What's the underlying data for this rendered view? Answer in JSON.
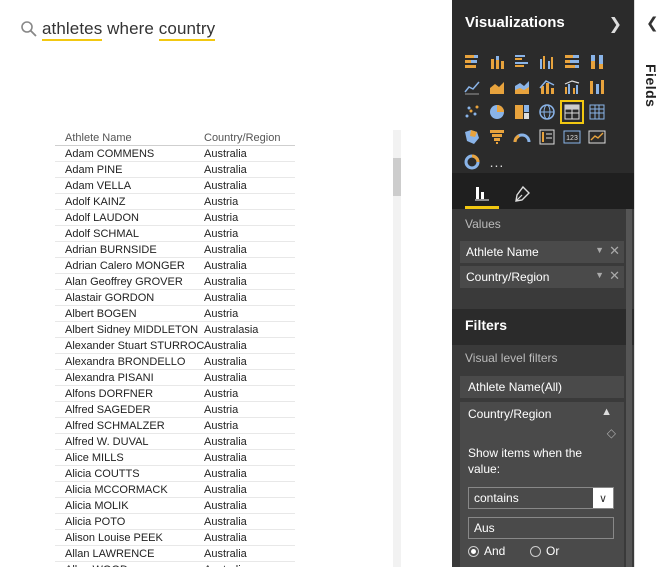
{
  "qna": {
    "words": [
      {
        "text": "athletes",
        "highlight": true
      },
      {
        "text": " where ",
        "highlight": false
      },
      {
        "text": "country",
        "highlight": true
      }
    ]
  },
  "table": {
    "headers": [
      "Athlete Name",
      "Country/Region"
    ],
    "rows": [
      [
        "Adam COMMENS",
        "Australia"
      ],
      [
        "Adam PINE",
        "Australia"
      ],
      [
        "Adam VELLA",
        "Australia"
      ],
      [
        "Adolf KAINZ",
        "Austria"
      ],
      [
        "Adolf LAUDON",
        "Austria"
      ],
      [
        "Adolf SCHMAL",
        "Austria"
      ],
      [
        "Adrian BURNSIDE",
        "Australia"
      ],
      [
        "Adrian Calero MONGER",
        "Australia"
      ],
      [
        "Alan Geoffrey GROVER",
        "Australia"
      ],
      [
        "Alastair GORDON",
        "Australia"
      ],
      [
        "Albert BOGEN",
        "Austria"
      ],
      [
        "Albert Sidney MIDDLETON",
        "Australasia"
      ],
      [
        "Alexander Stuart STURROCK",
        "Australia"
      ],
      [
        "Alexandra BRONDELLO",
        "Australia"
      ],
      [
        "Alexandra PISANI",
        "Australia"
      ],
      [
        "Alfons DORFNER",
        "Austria"
      ],
      [
        "Alfred SAGEDER",
        "Austria"
      ],
      [
        "Alfred SCHMALZER",
        "Austria"
      ],
      [
        "Alfred W. DUVAL",
        "Australia"
      ],
      [
        "Alice MILLS",
        "Australia"
      ],
      [
        "Alicia COUTTS",
        "Australia"
      ],
      [
        "Alicia MCCORMACK",
        "Australia"
      ],
      [
        "Alicia MOLIK",
        "Australia"
      ],
      [
        "Alicia POTO",
        "Australia"
      ],
      [
        "Alison Louise PEEK",
        "Australia"
      ],
      [
        "Allan LAWRENCE",
        "Australia"
      ],
      [
        "Allan WOOD",
        "Australia"
      ]
    ]
  },
  "viz": {
    "title": "Visualizations",
    "collapse": "<",
    "more": "...",
    "values_label": "Values",
    "value_fields": [
      "Athlete Name",
      "Country/Region"
    ],
    "filters_title": "Filters",
    "visual_level_label": "Visual level filters",
    "filter_athlete": "Athlete Name(All)",
    "filter_country": {
      "name": "Country/Region",
      "show_text": "Show items when the value:",
      "operator": "contains",
      "value": "Aus",
      "and_label": "And",
      "or_label": "Or"
    }
  },
  "fields": {
    "title": "Fields",
    "collapse": "<"
  },
  "colors": {
    "accent": "#f2c811",
    "pane_bg": "#2b2b2b",
    "well_bg": "#3a3a3a"
  }
}
